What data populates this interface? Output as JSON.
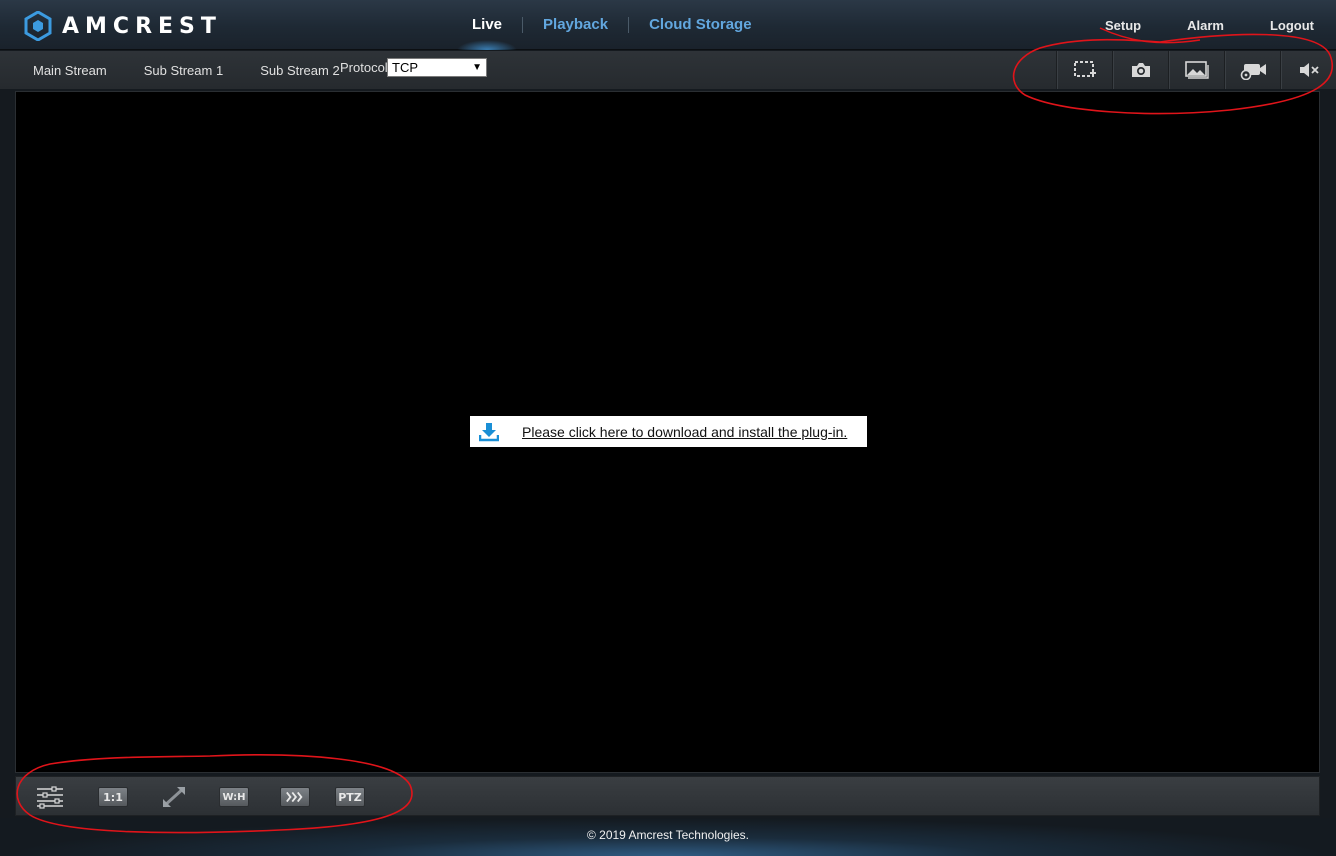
{
  "header": {
    "brand": "AMCREST",
    "nav": [
      "Live",
      "Playback",
      "Cloud Storage"
    ],
    "active_nav": "Live",
    "links": [
      "Setup",
      "Alarm",
      "Logout"
    ]
  },
  "subbar": {
    "streams": [
      "Main Stream",
      "Sub Stream 1",
      "Sub Stream 2"
    ],
    "protocol_label": "Protocol",
    "protocol_value": "TCP",
    "tool_icons": [
      "region-zoom-icon",
      "snapshot-camera-icon",
      "triple-snapshot-icon",
      "record-video-icon",
      "mute-speaker-icon"
    ]
  },
  "video": {
    "plugin_message": "Please click here to download and install the plug-in."
  },
  "controls": {
    "buttons": [
      {
        "icon": "image-adjust-icon",
        "label": ""
      },
      {
        "icon": "original-size-icon",
        "label": "1:1"
      },
      {
        "icon": "fullscreen-icon",
        "label": ""
      },
      {
        "icon": "aspect-ratio-icon",
        "label": "W:H"
      },
      {
        "icon": "fluency-icon",
        "label": ""
      },
      {
        "icon": "ptz-icon",
        "label": "PTZ"
      }
    ]
  },
  "footer": {
    "copyright": "© 2019 Amcrest Technologies."
  },
  "colors": {
    "nav_inactive": "#62a7df",
    "annotation_red": "#e0141a",
    "download_blue": "#1a8fd6"
  }
}
